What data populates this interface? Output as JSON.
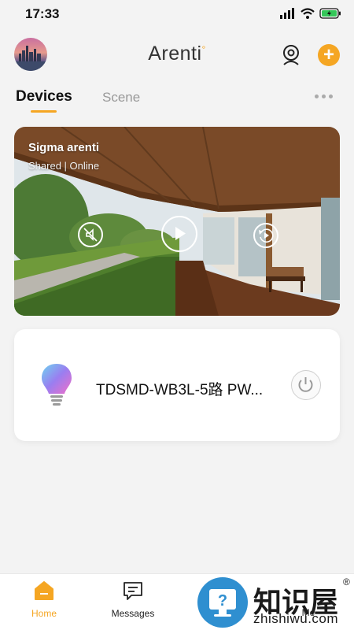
{
  "status_bar": {
    "time": "17:33"
  },
  "header": {
    "brand": "Arenti",
    "brand_dot": "°"
  },
  "tabs": {
    "devices": "Devices",
    "scene": "Scene"
  },
  "camera_card": {
    "name": "Sigma arenti",
    "status": "Shared | Online"
  },
  "device_card": {
    "name": "TDSMD-WB3L-5路 PW..."
  },
  "nav": {
    "home": "Home",
    "messages": "Messages",
    "me": "Me"
  },
  "watermark": {
    "text": "知识屋",
    "sub": "zhishiwu.com",
    "reg": "®"
  },
  "colors": {
    "accent": "#f5a623",
    "background": "#f3f3f3"
  },
  "icons": [
    "wifi-icon",
    "signal-icon",
    "battery-icon",
    "camera-icon",
    "plus-icon",
    "ellipsis-icon",
    "mute-icon",
    "play-icon",
    "playback-icon",
    "bulb-icon",
    "power-icon",
    "home-icon",
    "messages-icon"
  ]
}
